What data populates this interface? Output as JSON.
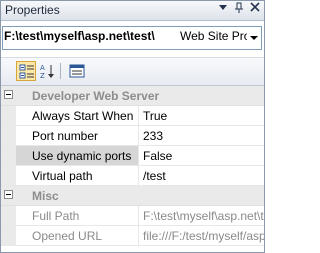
{
  "window": {
    "title": "Properties",
    "buttons": [
      "▾",
      "⊞",
      "✕"
    ]
  },
  "selector": {
    "object_name": "F:\\test\\myself\\asp.net\\test\\",
    "object_type": "Web Site Prop"
  },
  "toolbar": {
    "buttons": [
      {
        "name": "categorized",
        "icon": "categorized-icon",
        "active": true
      },
      {
        "name": "alphabetical",
        "icon": "alphabetical-sort-icon",
        "active": false
      },
      {
        "name": "property-pages",
        "icon": "property-pages-icon",
        "active": false
      }
    ]
  },
  "grid": {
    "categories": [
      {
        "label": "Developer Web Server",
        "properties": [
          {
            "name": "Always Start When",
            "value": "True"
          },
          {
            "name": "Port number",
            "value": "233"
          },
          {
            "name": "Use dynamic ports",
            "value": "False",
            "selected": true
          },
          {
            "name": "Virtual path",
            "value": "/test"
          }
        ]
      },
      {
        "label": "Misc",
        "properties": [
          {
            "name": "Full Path",
            "value": "F:\\test\\myself\\asp.net\\test\\",
            "readonly": true
          },
          {
            "name": "Opened URL",
            "value": "file:///F:/test/myself/asp.net/test/",
            "readonly": true
          }
        ]
      }
    ]
  }
}
